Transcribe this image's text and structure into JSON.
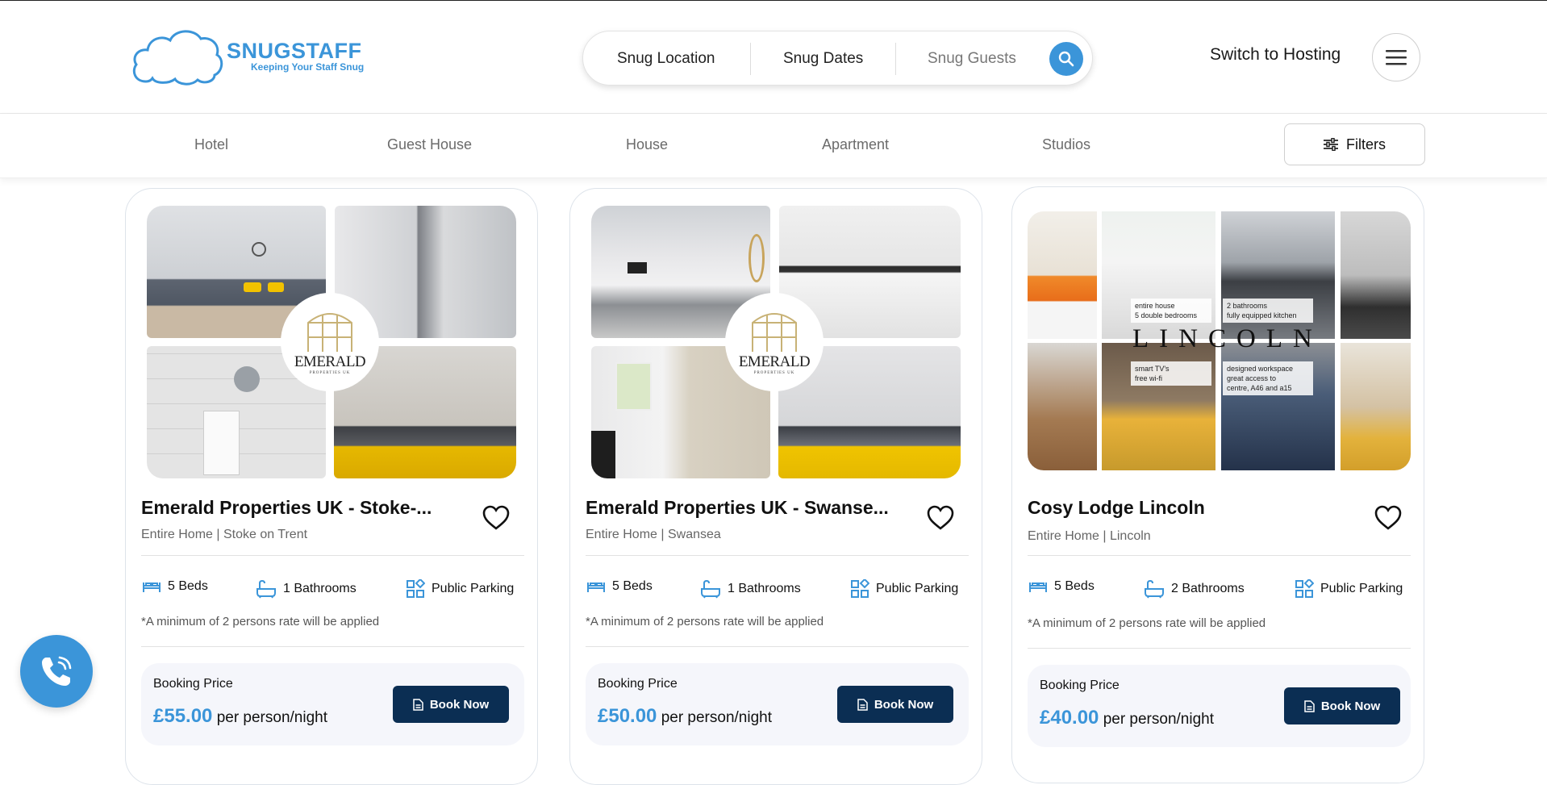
{
  "brand": {
    "name": "SNUGSTAFF",
    "tagline": "Keeping Your Staff Snug",
    "color": "#3b95d9"
  },
  "search": {
    "location_label": "Snug Location",
    "dates_label": "Snug Dates",
    "guests_label": "Snug Guests",
    "icon": "search-icon"
  },
  "header": {
    "switch_hosting": "Switch to Hosting",
    "menu_icon": "hamburger-icon"
  },
  "categories": [
    "Hotel",
    "Guest House",
    "House",
    "Apartment",
    "Studios"
  ],
  "filters_label": "Filters",
  "listings": [
    {
      "title": "Emerald Properties UK - Stoke-...",
      "subtitle": "Entire Home | Stoke on Trent",
      "beds": "5 Beds",
      "bathrooms": "1 Bathrooms",
      "parking": "Public Parking",
      "note": "*A minimum of 2 persons rate will be applied",
      "price_label": "Booking Price",
      "price": "£55.00",
      "price_unit": "per person/night",
      "book_label": "Book Now",
      "logo_text": "EMERALD",
      "logo_sub": "PROPERTIES UK"
    },
    {
      "title": "Emerald Properties UK - Swanse...",
      "subtitle": "Entire Home | Swansea",
      "beds": "5 Beds",
      "bathrooms": "1 Bathrooms",
      "parking": "Public Parking",
      "note": "*A minimum of 2 persons rate will be applied",
      "price_label": "Booking Price",
      "price": "£50.00",
      "price_unit": "per person/night",
      "book_label": "Book Now",
      "logo_text": "EMERALD",
      "logo_sub": "PROPERTIES UK"
    },
    {
      "title": "Cosy Lodge Lincoln",
      "subtitle": "Entire Home | Lincoln",
      "beds": "5 Beds",
      "bathrooms": "2 Bathrooms",
      "parking": "Public Parking",
      "note": "*A minimum of 2 persons rate will be applied",
      "price_label": "Booking Price",
      "price": "£40.00",
      "price_unit": "per person/night",
      "book_label": "Book Now",
      "overlay": {
        "word": "LINCOLN",
        "tl": [
          "entire house",
          "5 double bedrooms"
        ],
        "tr": [
          "2 bathrooms",
          "fully equipped kitchen"
        ],
        "bl": [
          "smart TV's",
          "free wi-fi"
        ],
        "br": [
          "designed workspace",
          "great access to",
          "centre, A46 and a15"
        ]
      }
    }
  ],
  "colors": {
    "accent": "#3b95d9",
    "button_dark": "#0b2e53",
    "price_bg": "#f5f6fb"
  }
}
